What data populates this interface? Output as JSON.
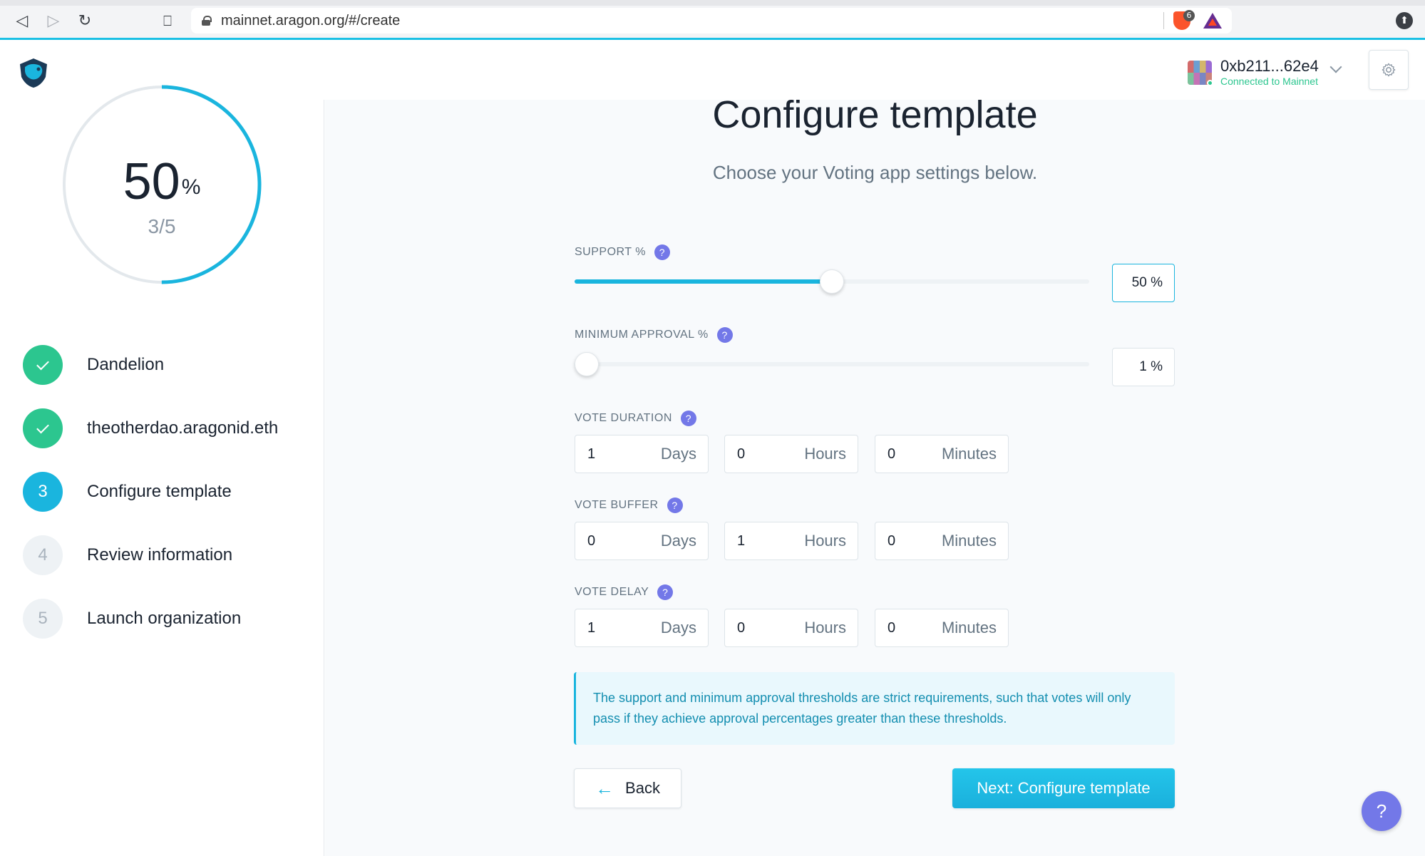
{
  "browser": {
    "url": "mainnet.aragon.org/#/create",
    "shield_count": "6"
  },
  "account": {
    "address": "0xb211...62e4",
    "status": "Connected to Mainnet"
  },
  "progress": {
    "value": "50",
    "unit": "%",
    "steps": "3/5",
    "fraction": 0.5
  },
  "steps": [
    {
      "number": "1",
      "label": "Dandelion",
      "state": "done"
    },
    {
      "number": "2",
      "label": "theotherdao.aragonid.eth",
      "state": "done"
    },
    {
      "number": "3",
      "label": "Configure template",
      "state": "current"
    },
    {
      "number": "4",
      "label": "Review information",
      "state": "todo"
    },
    {
      "number": "5",
      "label": "Launch organization",
      "state": "todo"
    }
  ],
  "main": {
    "title": "Configure template",
    "subtitle": "Choose your Voting app settings below.",
    "support": {
      "label": "SUPPORT %",
      "value": "50",
      "unit": "%",
      "fraction": 0.5
    },
    "min_approval": {
      "label": "MINIMUM APPROVAL %",
      "value": "1",
      "unit": "%",
      "fraction": 0.01
    },
    "vote_duration": {
      "label": "VOTE DURATION",
      "days": "1",
      "hours": "0",
      "minutes": "0"
    },
    "vote_buffer": {
      "label": "VOTE BUFFER",
      "days": "0",
      "hours": "1",
      "minutes": "0"
    },
    "vote_delay": {
      "label": "VOTE DELAY",
      "days": "1",
      "hours": "0",
      "minutes": "0"
    },
    "units": {
      "days": "Days",
      "hours": "Hours",
      "minutes": "Minutes"
    },
    "help_glyph": "?",
    "info": "The support and minimum approval thresholds are strict requirements, such that votes will only pass if they achieve approval percentages greater than these thresholds.",
    "back_label": "Back",
    "next_label": "Next: Configure template"
  },
  "colors": {
    "accent": "#1ab5de",
    "success": "#2cc68f",
    "help": "#7378e8"
  }
}
